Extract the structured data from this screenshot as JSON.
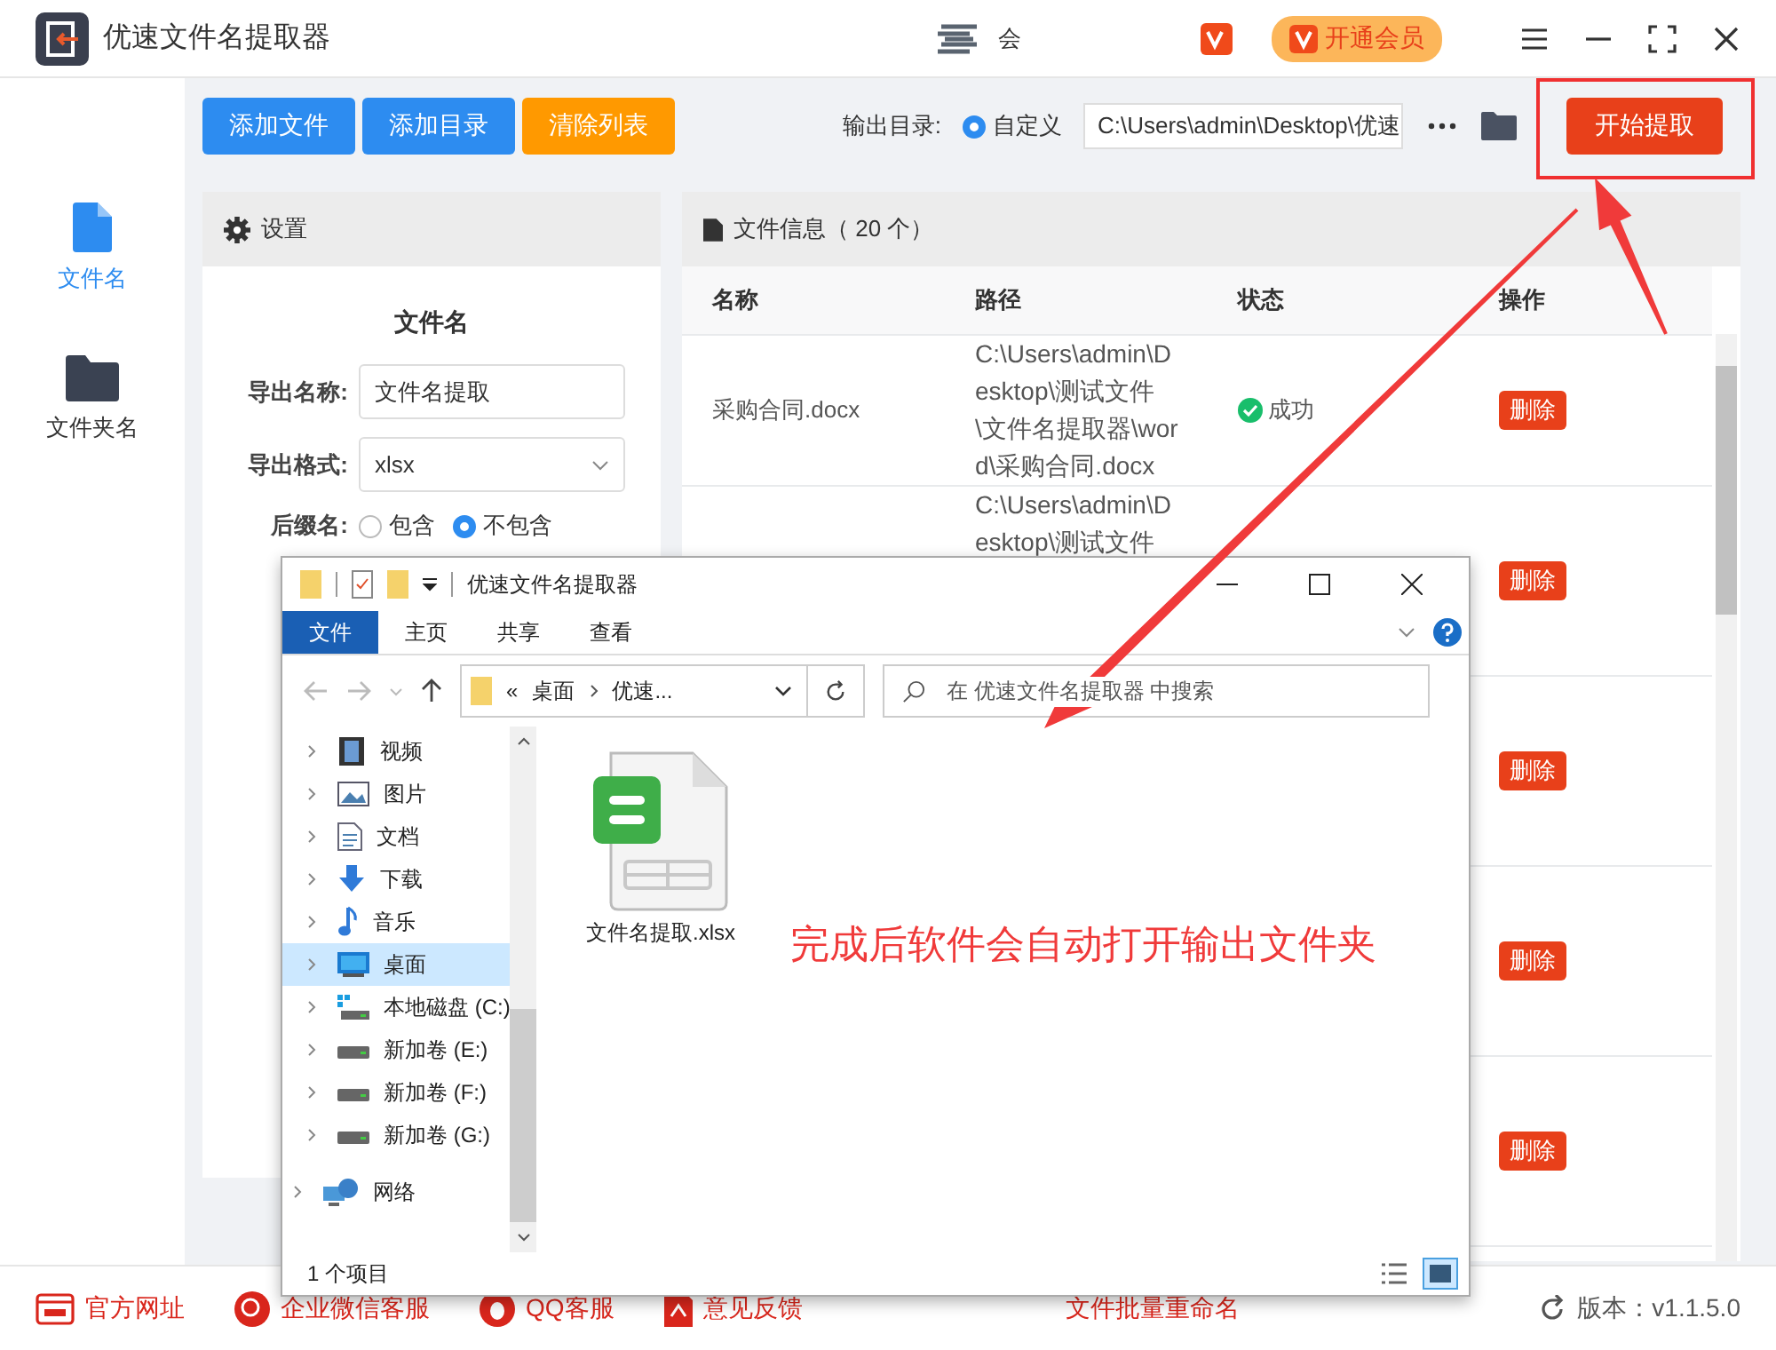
{
  "app": {
    "title": "优速文件名提取器",
    "center_label": "会",
    "vip_button": "开通会员"
  },
  "sidebar": [
    {
      "label": "文件名",
      "selected": true
    },
    {
      "label": "文件夹名",
      "selected": false
    }
  ],
  "toolbar": {
    "buttons": [
      {
        "label": "添加文件",
        "kind": "primary"
      },
      {
        "label": "添加目录",
        "kind": "primary"
      },
      {
        "label": "清除列表",
        "kind": "warning"
      }
    ],
    "output_label": "输出目录:",
    "radio": {
      "label": "自定义",
      "selected": true
    },
    "path": "C:\\Users\\admin\\Desktop\\优速",
    "start": "开始提取"
  },
  "settings": {
    "title": "设置",
    "section": "文件名",
    "fields": [
      {
        "label": "导出名称:",
        "value": "文件名提取",
        "kind": "text"
      },
      {
        "label": "导出格式:",
        "value": "xlsx",
        "kind": "select"
      }
    ],
    "suffix": {
      "label": "后缀名:",
      "options": [
        {
          "label": "包含",
          "selected": false
        },
        {
          "label": "不包含",
          "selected": true
        }
      ]
    }
  },
  "files": {
    "title": "文件信息（ 20 个）",
    "columns": [
      "名称",
      "路径",
      "状态",
      "操作"
    ],
    "rows": [
      {
        "name": "采购合同.docx",
        "path": "C:\\Users\\admin\\Desktop\\测试文件\\文件名提取器\\word\\采购合同.docx",
        "status": "成功",
        "action": "删除"
      },
      {
        "path": "C:\\Users\\admin\\Desktop\\测试文件",
        "action": "删除"
      },
      {
        "action": "删除"
      },
      {
        "action": "删除"
      },
      {
        "action": "删除"
      }
    ]
  },
  "explorer": {
    "title": "优速文件名提取器",
    "tabs": [
      {
        "label": "文件",
        "selected": true
      },
      {
        "label": "主页",
        "selected": false
      },
      {
        "label": "共享",
        "selected": false
      },
      {
        "label": "查看",
        "selected": false
      }
    ],
    "breadcrumb_prefix": "«",
    "breadcrumb": [
      "桌面",
      "优速..."
    ],
    "search_placeholder": "在 优速文件名提取器 中搜索",
    "nav": [
      {
        "label": "视频",
        "selected": false
      },
      {
        "label": "图片",
        "selected": false
      },
      {
        "label": "文档",
        "selected": false
      },
      {
        "label": "下载",
        "selected": false
      },
      {
        "label": "音乐",
        "selected": false
      },
      {
        "label": "桌面",
        "selected": true
      },
      {
        "label": "本地磁盘 (C:)",
        "selected": false
      },
      {
        "label": "新加卷 (E:)",
        "selected": false
      },
      {
        "label": "新加卷 (F:)",
        "selected": false
      },
      {
        "label": "新加卷 (G:)",
        "selected": false
      },
      {
        "label": "网络",
        "selected": false
      }
    ],
    "files": [
      {
        "name": "文件名提取.xlsx"
      }
    ],
    "status": "1 个项目"
  },
  "annotation": "完成后软件会自动打开输出文件夹",
  "footer": {
    "links": [
      {
        "label": "官方网址"
      },
      {
        "label": "企业微信客服"
      },
      {
        "label": "QQ客服"
      },
      {
        "label": "意见反馈"
      }
    ],
    "center": "文件批量重命名",
    "version": "版本：v1.1.5.0"
  }
}
